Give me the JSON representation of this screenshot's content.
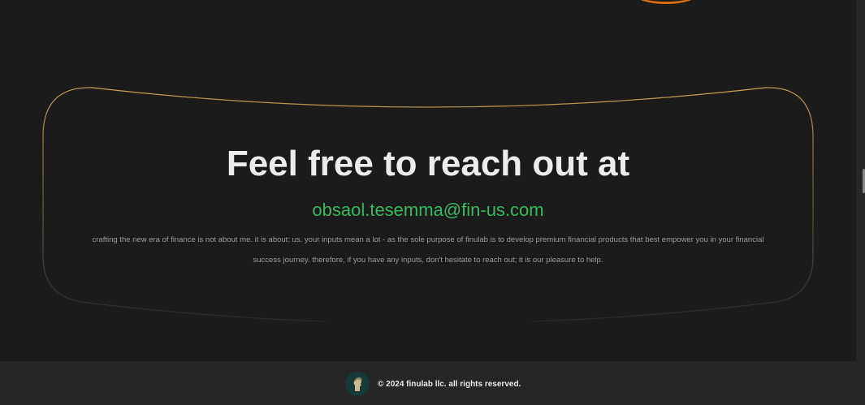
{
  "contact": {
    "headline": "Feel free to reach out at",
    "email": "obsaol.tesemma@fin-us.com",
    "about": "crafting the new era of finance is not about me. it is about: us. your inputs mean a lot - as the sole purpose of finulab is to develop premium financial products that best empower you in your financial success journey. therefore, if you have any inputs, don't hesitate to reach out; it is our pleasure to help."
  },
  "footer": {
    "copyright": "© 2024 finulab llc. all rights reserved."
  },
  "colors": {
    "background": "#1b1b1b",
    "footer_background": "#262626",
    "headline": "#ececec",
    "email": "#3cb760",
    "card_border": "#c8a15a",
    "accent_orange": "#d96a0e"
  },
  "icons": {
    "footer_logo": "finulab-logo-icon"
  }
}
